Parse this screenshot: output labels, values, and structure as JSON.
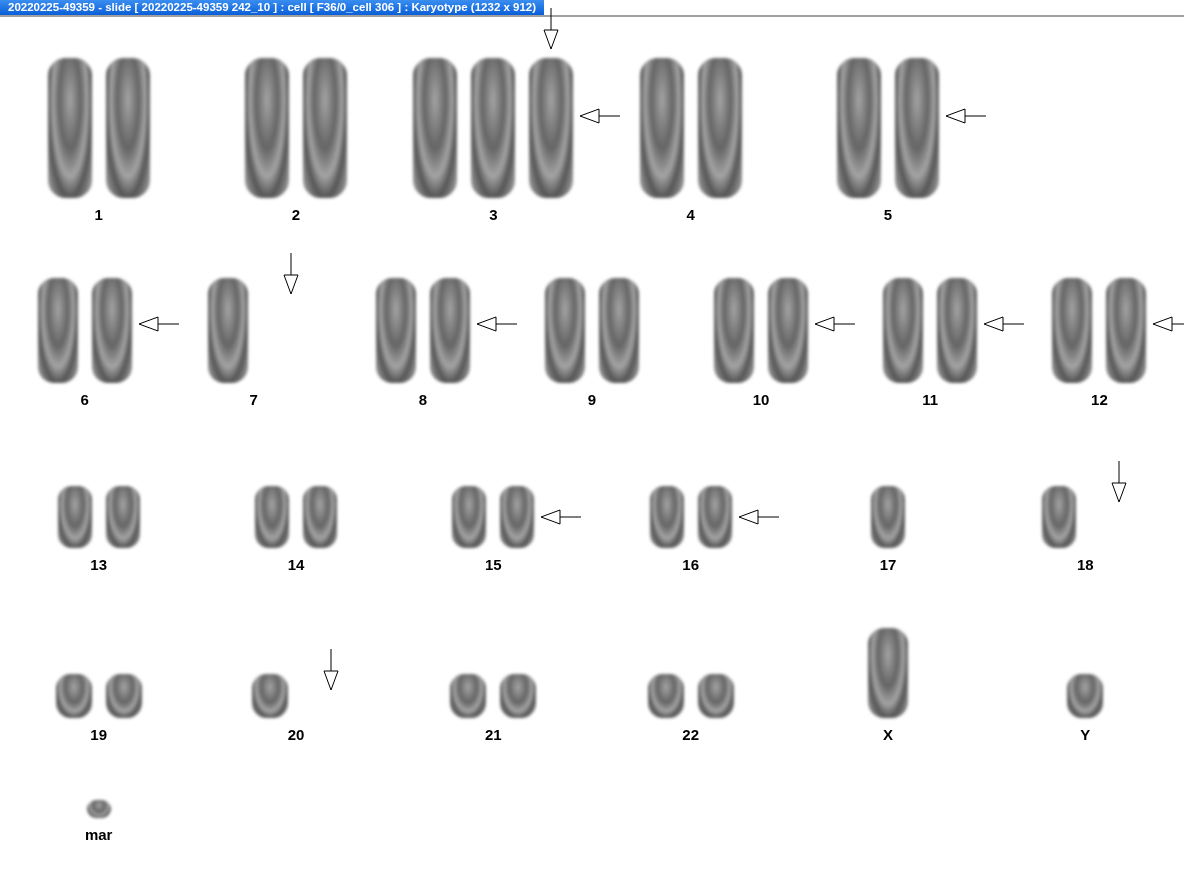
{
  "window": {
    "title": "20220225-49359 - slide [ 20220225-49359 242_10 ] : cell [ F36/0_cell 306 ] : Karyotype  (1232 x 912)"
  },
  "rows": [
    {
      "groups": [
        {
          "label": "1",
          "chromosomes": [
            {
              "kind": "plain"
            },
            {
              "kind": "plain"
            }
          ]
        },
        {
          "label": "2",
          "chromosomes": [
            {
              "kind": "plain"
            },
            {
              "kind": "plain"
            }
          ]
        },
        {
          "label": "3",
          "chromosomes": [
            {
              "kind": "plain"
            },
            {
              "kind": "plain"
            },
            {
              "kind": "flagged"
            }
          ]
        },
        {
          "label": "4",
          "chromosomes": [
            {
              "kind": "plain"
            },
            {
              "kind": "plain"
            }
          ]
        },
        {
          "label": "5",
          "chromosomes": [
            {
              "kind": "plain"
            },
            {
              "kind": "pointed"
            }
          ]
        }
      ]
    },
    {
      "groups": [
        {
          "label": "6",
          "chromosomes": [
            {
              "kind": "plain"
            },
            {
              "kind": "pointed"
            }
          ]
        },
        {
          "label": "7",
          "missing_marker": true,
          "chromosomes": [
            {
              "kind": "plain"
            }
          ]
        },
        {
          "label": "8",
          "chromosomes": [
            {
              "kind": "plain"
            },
            {
              "kind": "pointed"
            }
          ]
        },
        {
          "label": "9",
          "chromosomes": [
            {
              "kind": "plain"
            },
            {
              "kind": "plain"
            }
          ]
        },
        {
          "label": "10",
          "chromosomes": [
            {
              "kind": "plain"
            },
            {
              "kind": "pointed"
            }
          ]
        },
        {
          "label": "11",
          "chromosomes": [
            {
              "kind": "plain"
            },
            {
              "kind": "pointed"
            }
          ]
        },
        {
          "label": "12",
          "chromosomes": [
            {
              "kind": "plain"
            },
            {
              "kind": "pointed"
            }
          ]
        }
      ]
    },
    {
      "groups": [
        {
          "label": "13",
          "chromosomes": [
            {
              "kind": "plain"
            },
            {
              "kind": "plain"
            }
          ]
        },
        {
          "label": "14",
          "chromosomes": [
            {
              "kind": "plain"
            },
            {
              "kind": "plain"
            }
          ]
        },
        {
          "label": "15",
          "chromosomes": [
            {
              "kind": "plain"
            },
            {
              "kind": "pointed"
            }
          ]
        },
        {
          "label": "16",
          "chromosomes": [
            {
              "kind": "plain"
            },
            {
              "kind": "pointed"
            }
          ]
        },
        {
          "label": "17",
          "chromosomes": [
            {
              "kind": "plain"
            }
          ]
        },
        {
          "label": "18",
          "missing_marker": true,
          "chromosomes": [
            {
              "kind": "plain"
            }
          ]
        }
      ]
    },
    {
      "groups": [
        {
          "label": "19",
          "chromosomes": [
            {
              "kind": "plain"
            },
            {
              "kind": "plain"
            }
          ]
        },
        {
          "label": "20",
          "missing_marker": true,
          "chromosomes": [
            {
              "kind": "plain"
            }
          ]
        },
        {
          "label": "21",
          "chromosomes": [
            {
              "kind": "plain"
            },
            {
              "kind": "plain"
            }
          ]
        },
        {
          "label": "22",
          "chromosomes": [
            {
              "kind": "plain"
            },
            {
              "kind": "plain"
            }
          ]
        },
        {
          "label": "X",
          "chromosomes": [
            {
              "kind": "plain"
            }
          ]
        },
        {
          "label": "Y",
          "chromosomes": [
            {
              "kind": "plain"
            }
          ]
        }
      ]
    },
    {
      "groups": [
        {
          "label": "mar",
          "chromosomes": [
            {
              "kind": "plain"
            }
          ]
        }
      ]
    }
  ]
}
